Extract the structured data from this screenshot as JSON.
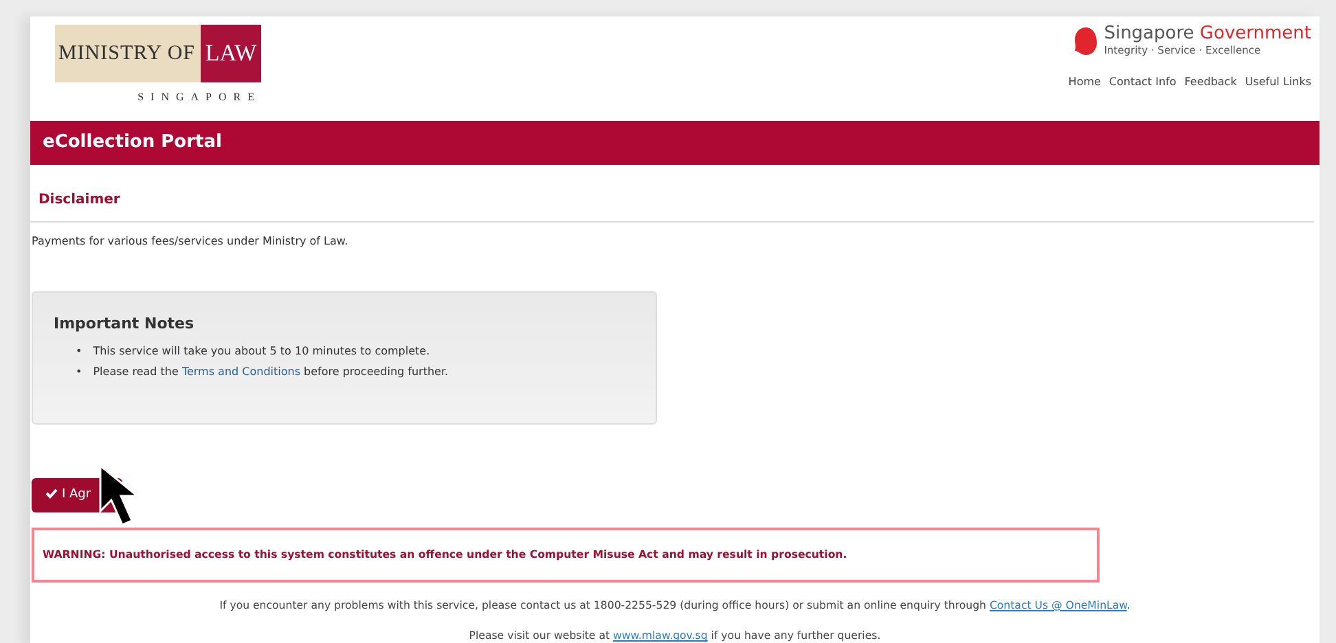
{
  "logo": {
    "words": "MINISTRY OF",
    "emphasis": "LAW",
    "country": "SINGAPORE"
  },
  "gov_logo": {
    "name": "Singapore",
    "accent": "Government",
    "motto": "Integrity · Service · Excellence"
  },
  "top_links": [
    "Home",
    "Contact Info",
    "Feedback",
    "Useful Links"
  ],
  "banner": {
    "title": "eCollection Portal"
  },
  "section": {
    "title": "Disclaimer",
    "intro": "Payments for various fees/services under Ministry of Law."
  },
  "notes": {
    "title": "Important Notes",
    "items": [
      {
        "bullet": "•",
        "before": "This service will take you about 5 to 10 minutes to complete."
      },
      {
        "bullet": "•",
        "before": "Please read the ",
        "link": "Terms and Conditions",
        "after": " before proceeding further."
      }
    ]
  },
  "agree_button": {
    "label": "I Agr"
  },
  "warning": "WARNING: Unauthorised access to this system constitutes an offence under the Computer Misuse Act and may result in prosecution.",
  "footer": [
    {
      "before": "If you encounter any problems with this service, please contact us at 1800-2255-529 (during office hours) or submit an online enquiry through ",
      "link": "Contact Us @ OneMinLaw",
      "after": "."
    },
    {
      "before": "Please visit our website at ",
      "link": "www.mlaw.gov.sg",
      "after": " if you have any further queries."
    }
  ]
}
